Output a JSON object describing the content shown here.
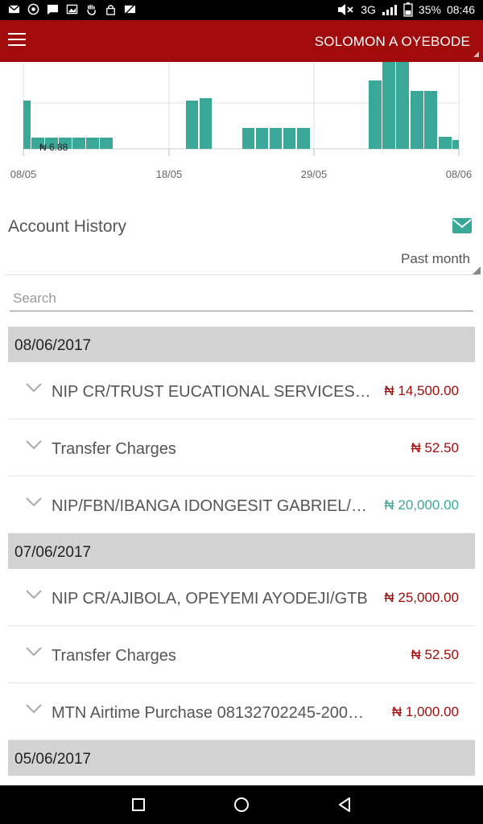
{
  "statusbar": {
    "icons": [
      "mail-icon",
      "whatsapp-icon",
      "message-icon",
      "image-icon",
      "hand-icon",
      "lock-icon",
      "mail-off-icon"
    ],
    "network": "3G",
    "battery": "35%",
    "time": "08:46"
  },
  "appbar": {
    "user_name": "SOLOMON A OYEBODE"
  },
  "chart_data": {
    "type": "bar",
    "x_tick_labels": [
      "08/05",
      "18/05",
      "29/05",
      "08/06"
    ],
    "annotation": "₦ 6.88",
    "series_color": "#3aa898",
    "grid": true
  },
  "history": {
    "title": "Account History",
    "period": "Past month",
    "search_placeholder": "Search"
  },
  "groups": [
    {
      "date": "08/06/2017",
      "rows": [
        {
          "desc": "NIP CR/TRUST EUCATIONAL SERVICES…",
          "amount": "₦ 14,500.00",
          "type": "debit"
        },
        {
          "desc": "Transfer Charges",
          "amount": "₦ 52.50",
          "type": "debit"
        },
        {
          "desc": "NIP/FBN/IBANGA IDONGESIT GABRIEL/…",
          "amount": "₦ 20,000.00",
          "type": "credit"
        }
      ]
    },
    {
      "date": "07/06/2017",
      "rows": [
        {
          "desc": "NIP CR/AJIBOLA, OPEYEMI AYODEJI/GTB",
          "amount": "₦ 25,000.00",
          "type": "debit"
        },
        {
          "desc": "Transfer Charges",
          "amount": "₦ 52.50",
          "type": "debit"
        },
        {
          "desc": "MTN Airtime Purchase 08132702245-200…",
          "amount": "₦ 1,000.00",
          "type": "debit"
        }
      ]
    },
    {
      "date": "05/06/2017",
      "rows": []
    }
  ],
  "navbar": {
    "icons": [
      "recents-square-icon",
      "home-circle-icon",
      "back-triangle-icon"
    ]
  }
}
